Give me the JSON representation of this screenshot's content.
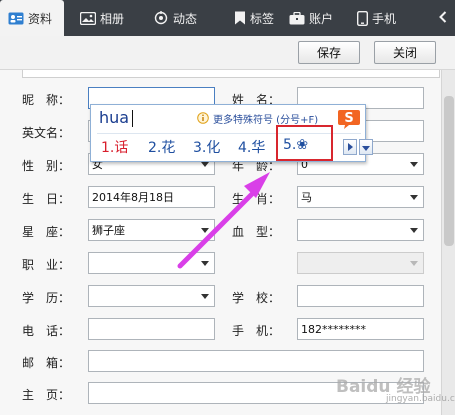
{
  "tabs": [
    {
      "label": "资料",
      "icon": "profile-card-icon",
      "active": true
    },
    {
      "label": "相册",
      "icon": "photo-album-icon",
      "active": false
    },
    {
      "label": "动态",
      "icon": "activity-icon",
      "active": false
    },
    {
      "label": "标签",
      "icon": "bookmark-tag-icon",
      "active": false
    },
    {
      "label": "账户",
      "icon": "briefcase-icon",
      "active": false
    },
    {
      "label": "手机",
      "icon": "phone-icon",
      "active": false
    }
  ],
  "toolbar": {
    "save_label": "保存",
    "close_label": "关闭"
  },
  "form": {
    "nickname": {
      "label": "昵　称：",
      "value": ""
    },
    "english_name": {
      "label": "英文名：",
      "value": ""
    },
    "gender": {
      "label": "性　别：",
      "value": "女"
    },
    "birthday": {
      "label": "生　日：",
      "value": "2014年8月18日"
    },
    "constellation": {
      "label": "星　座：",
      "value": "狮子座"
    },
    "job": {
      "label": "职　业：",
      "value": ""
    },
    "education": {
      "label": "学　历：",
      "value": ""
    },
    "telephone": {
      "label": "电　话：",
      "value": ""
    },
    "email": {
      "label": "邮　箱：",
      "value": ""
    },
    "homepage": {
      "label": "主　页：",
      "value": ""
    },
    "name": {
      "label": "姓　名：",
      "value": ""
    },
    "age": {
      "label": "年　龄：",
      "value": "0"
    },
    "zodiac": {
      "label": "生　肖：",
      "value": "马"
    },
    "blood_type": {
      "label": "血　型：",
      "value": ""
    },
    "school": {
      "label": "学　校：",
      "value": ""
    },
    "mobile": {
      "label": "手　机：",
      "value": "182********"
    }
  },
  "ime": {
    "input": "hua",
    "hint": "更多特殊符号 (分号+F)",
    "candidates": [
      "1.话",
      "2.花",
      "3.化",
      "4.华",
      "5.❀"
    ],
    "logo": "S"
  },
  "watermark": {
    "text": "Baidu 经验",
    "sub": "jingyan.baidu.com"
  },
  "colors": {
    "tabbar_bg": "#3a3f45",
    "ime_first": "#d81e2c",
    "ime_text": "#1f4fa0",
    "highlight": "#d8262e",
    "arrow": "#d93fe8",
    "logo": "#f26522"
  }
}
